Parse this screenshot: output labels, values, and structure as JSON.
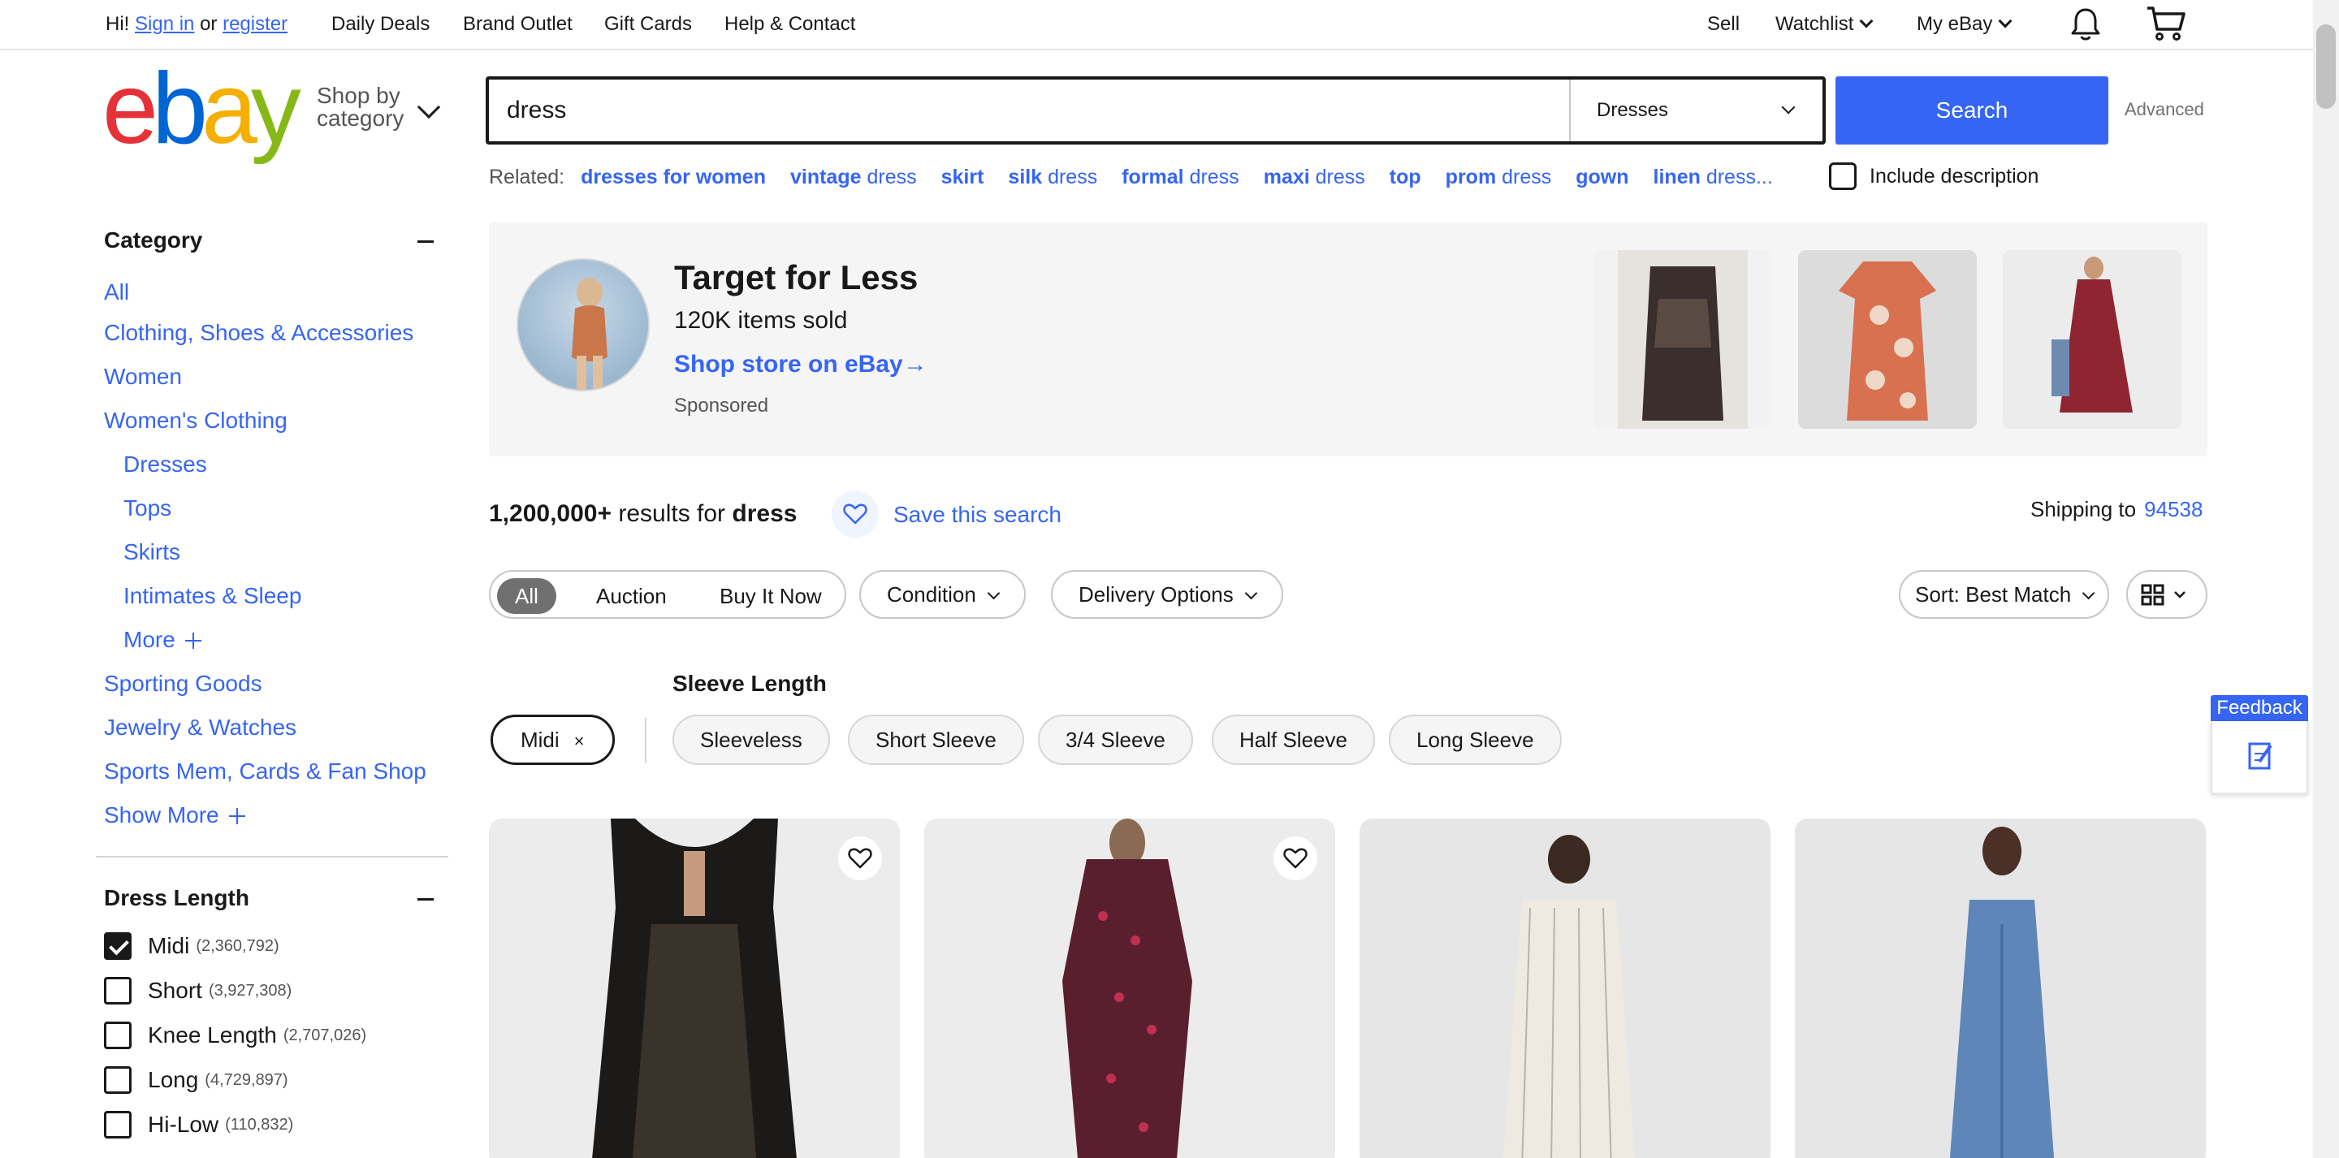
{
  "topnav": {
    "greeting": "Hi!",
    "sign_in": "Sign in",
    "or": "or",
    "register": "register",
    "daily_deals": "Daily Deals",
    "brand_outlet": "Brand Outlet",
    "gift_cards": "Gift Cards",
    "help_contact": "Help & Contact",
    "sell": "Sell",
    "watchlist": "Watchlist",
    "my_ebay": "My eBay"
  },
  "header": {
    "logo_letters": [
      "e",
      "b",
      "a",
      "y"
    ],
    "shop_by_line1": "Shop by",
    "shop_by_line2": "category",
    "search_value": "dress",
    "search_category": "Dresses",
    "search_button": "Search",
    "advanced": "Advanced",
    "related_label": "Related:",
    "related": [
      {
        "bold": "dresses for women",
        "rest": ""
      },
      {
        "bold": "vintage",
        "rest": " dress"
      },
      {
        "bold": "skirt",
        "rest": ""
      },
      {
        "bold": "silk",
        "rest": " dress"
      },
      {
        "bold": "formal",
        "rest": " dress"
      },
      {
        "bold": "maxi",
        "rest": " dress"
      },
      {
        "bold": "top",
        "rest": ""
      },
      {
        "bold": "prom",
        "rest": " dress"
      },
      {
        "bold": "gown",
        "rest": ""
      },
      {
        "bold": "linen",
        "rest": " dress..."
      }
    ],
    "include_description": "Include description"
  },
  "sidebar": {
    "category_heading": "Category",
    "links": {
      "all": "All",
      "clothing": "Clothing, Shoes & Accessories",
      "women": "Women",
      "womens_clothing": "Women's Clothing",
      "dresses": "Dresses",
      "tops": "Tops",
      "skirts": "Skirts",
      "intimates": "Intimates & Sleep",
      "more": "More",
      "sporting": "Sporting Goods",
      "jewelry": "Jewelry & Watches",
      "sports_mem": "Sports Mem, Cards & Fan Shop",
      "show_more": "Show More"
    },
    "dress_length_heading": "Dress Length",
    "dress_length": [
      {
        "label": "Midi",
        "count": "(2,360,792)",
        "checked": true
      },
      {
        "label": "Short",
        "count": "(3,927,308)",
        "checked": false
      },
      {
        "label": "Knee Length",
        "count": "(2,707,026)",
        "checked": false
      },
      {
        "label": "Long",
        "count": "(4,729,897)",
        "checked": false
      },
      {
        "label": "Hi-Low",
        "count": "(110,832)",
        "checked": false
      }
    ]
  },
  "promo": {
    "title": "Target for Less",
    "sold": "120K items sold",
    "link": "Shop store on eBay",
    "sponsored": "Sponsored"
  },
  "results": {
    "count": "1,200,000+",
    "results_for": "results for",
    "query": "dress",
    "save_search": "Save this search",
    "shipping_to": "Shipping to",
    "zip": "94538"
  },
  "filters": {
    "seg_all": "All",
    "seg_auction": "Auction",
    "seg_buy": "Buy It Now",
    "condition": "Condition",
    "delivery": "Delivery Options",
    "sort": "Sort: Best Match"
  },
  "sleeve": {
    "title": "Sleeve Length",
    "active_chip": "Midi",
    "active_chip_x": "×",
    "options": [
      "Sleeveless",
      "Short Sleeve",
      "3/4 Sleeve",
      "Half Sleeve",
      "Long Sleeve"
    ]
  },
  "feedback": "Feedback",
  "colors": {
    "accent": "#3665f3",
    "text": "#191919"
  }
}
